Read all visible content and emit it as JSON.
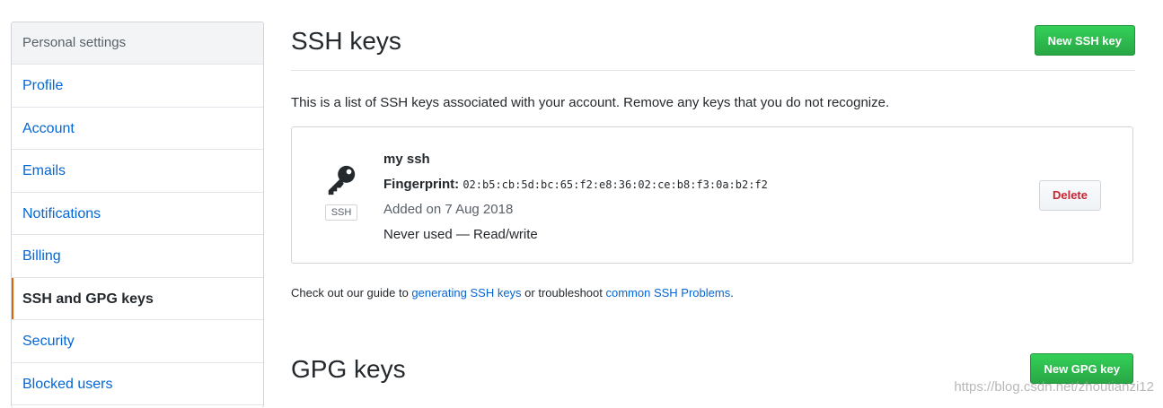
{
  "sidebar": {
    "header": "Personal settings",
    "items": [
      {
        "label": "Profile"
      },
      {
        "label": "Account"
      },
      {
        "label": "Emails"
      },
      {
        "label": "Notifications"
      },
      {
        "label": "Billing"
      },
      {
        "label": "SSH and GPG keys",
        "selected": true
      },
      {
        "label": "Security"
      },
      {
        "label": "Blocked users"
      }
    ]
  },
  "ssh": {
    "title": "SSH keys",
    "new_button": "New SSH key",
    "description": "This is a list of SSH keys associated with your account. Remove any keys that you do not recognize.",
    "key": {
      "icon": "key-icon",
      "badge": "SSH",
      "name": "my ssh",
      "fingerprint_label": "Fingerprint:",
      "fingerprint": "02:b5:cb:5d:bc:65:f2:e8:36:02:ce:b8:f3:0a:b2:f2",
      "added": "Added on 7 Aug 2018",
      "usage": "Never used — Read/write",
      "delete_button": "Delete"
    },
    "guide": {
      "prefix": "Check out our guide to ",
      "link1": "generating SSH keys",
      "middle": " or troubleshoot ",
      "link2": "common SSH Problems",
      "suffix": "."
    }
  },
  "gpg": {
    "title": "GPG keys",
    "new_button": "New GPG key"
  },
  "watermark": "https://blog.csdn.net/zhoutianzi12",
  "colors": {
    "accent_green": "#28a745",
    "link_blue": "#0366d6",
    "selected_marker": "#e36209",
    "danger_red": "#cb2431"
  }
}
